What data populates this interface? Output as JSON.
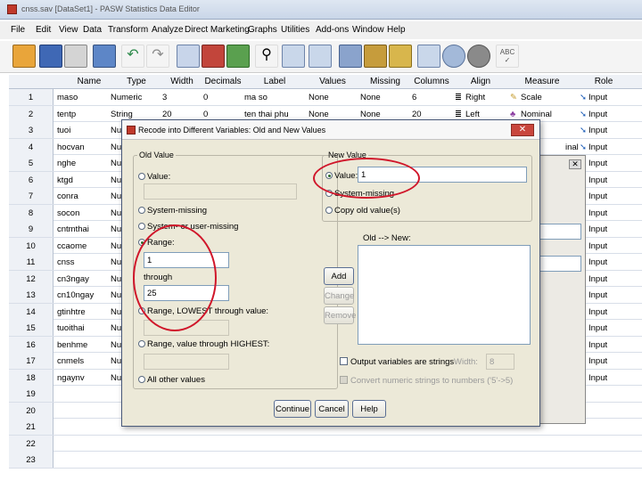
{
  "window": {
    "title": "cnss.sav [DataSet1] - PASW Statistics Data Editor"
  },
  "menu": [
    "File",
    "Edit",
    "View",
    "Data",
    "Transform",
    "Analyze",
    "Direct Marketing",
    "Graphs",
    "Utilities",
    "Add-ons",
    "Window",
    "Help"
  ],
  "toolbar_icons": [
    "open-folder-icon",
    "save-icon",
    "print-icon",
    "dialog-recall-icon",
    "undo-icon",
    "redo-icon",
    "goto-case-icon",
    "goto-variable-icon",
    "variables-icon",
    "find-icon",
    "insert-cases-icon",
    "insert-variable-icon",
    "split-file-icon",
    "weight-cases-icon",
    "select-cases-icon",
    "value-labels-icon",
    "use-sets-icon",
    "show-all-icon",
    "spell-check-icon"
  ],
  "grid": {
    "columns": [
      "Name",
      "Type",
      "Width",
      "Decimals",
      "Label",
      "Values",
      "Missing",
      "Columns",
      "Align",
      "Measure",
      "Role"
    ],
    "rows": [
      {
        "n": "1",
        "name": "maso",
        "type": "Numeric",
        "width": "3",
        "decimals": "0",
        "label": "ma so",
        "values": "None",
        "missing": "None",
        "columns": "6",
        "align": "Right",
        "measure": "Scale",
        "role": "Input"
      },
      {
        "n": "2",
        "name": "tentp",
        "type": "String",
        "width": "20",
        "decimals": "0",
        "label": "ten thai phu",
        "values": "None",
        "missing": "None",
        "columns": "20",
        "align": "Left",
        "measure": "Nominal",
        "role": "Input"
      },
      {
        "n": "3",
        "name": "tuoi",
        "type": "Nu",
        "role": "Input"
      },
      {
        "n": "4",
        "name": "hocvan",
        "type": "Nu",
        "measure": "inal",
        "role": "Input"
      },
      {
        "n": "5",
        "name": "nghe",
        "type": "Nu",
        "role": "Input"
      },
      {
        "n": "6",
        "name": "ktgd",
        "type": "Nu",
        "role": "Input"
      },
      {
        "n": "7",
        "name": "conra",
        "type": "Nu",
        "role": "Input"
      },
      {
        "n": "8",
        "name": "socon",
        "type": "Nu",
        "role": "Input"
      },
      {
        "n": "9",
        "name": "cntmthai",
        "type": "Nu",
        "role": "Input"
      },
      {
        "n": "10",
        "name": "ccaome",
        "type": "Nu",
        "role": "Input"
      },
      {
        "n": "11",
        "name": "cnss",
        "type": "Nu",
        "role": "Input"
      },
      {
        "n": "12",
        "name": "cn3ngay",
        "type": "Nu",
        "role": "Input"
      },
      {
        "n": "13",
        "name": "cn10ngay",
        "type": "Nu",
        "role": "Input"
      },
      {
        "n": "14",
        "name": "gtinhtre",
        "type": "Nu",
        "role": "Input"
      },
      {
        "n": "15",
        "name": "tuoithai",
        "type": "Nu",
        "role": "Input"
      },
      {
        "n": "16",
        "name": "benhme",
        "type": "Nu",
        "role": "Input"
      },
      {
        "n": "17",
        "name": "cnmels",
        "type": "Nu",
        "role": "Input"
      },
      {
        "n": "18",
        "name": "ngaynv",
        "type": "Nu",
        "role": "Input"
      },
      {
        "n": "19"
      },
      {
        "n": "20"
      },
      {
        "n": "21"
      },
      {
        "n": "22"
      },
      {
        "n": "23"
      }
    ]
  },
  "dialog": {
    "title": "Recode into Different Variables: Old and New Values",
    "close_label": "✕",
    "old_value": {
      "legend": "Old Value",
      "value_label": "Value:",
      "system_missing_label": "System-missing",
      "sys_user_missing_label": "System- or user-missing",
      "range_label": "Range:",
      "range_from": "1",
      "through_label": "through",
      "range_to": "25",
      "range_lowest_label": "Range, LOWEST through value:",
      "range_highest_label": "Range, value through HIGHEST:",
      "all_other_label": "All other values",
      "selected": "Range:"
    },
    "new_value": {
      "legend": "New Value",
      "value_label": "Value:",
      "value": "1",
      "system_missing_label": "System-missing",
      "copy_old_label": "Copy old value(s)",
      "selected": "Value:"
    },
    "old_new_label": "Old --> New:",
    "buttons": {
      "add": "Add",
      "change": "Change",
      "remove": "Remove",
      "continue": "Continue",
      "cancel": "Cancel",
      "help": "Help"
    },
    "output_strings_label": "Output variables are strings",
    "width_label": "Width:",
    "width_value": "8",
    "convert_label": "Convert numeric strings to numbers ('5'->5)"
  },
  "colors": {
    "annotation": "#d0162a",
    "grid_header": "#eef1f6",
    "dialog_bg": "#ece9d8"
  }
}
